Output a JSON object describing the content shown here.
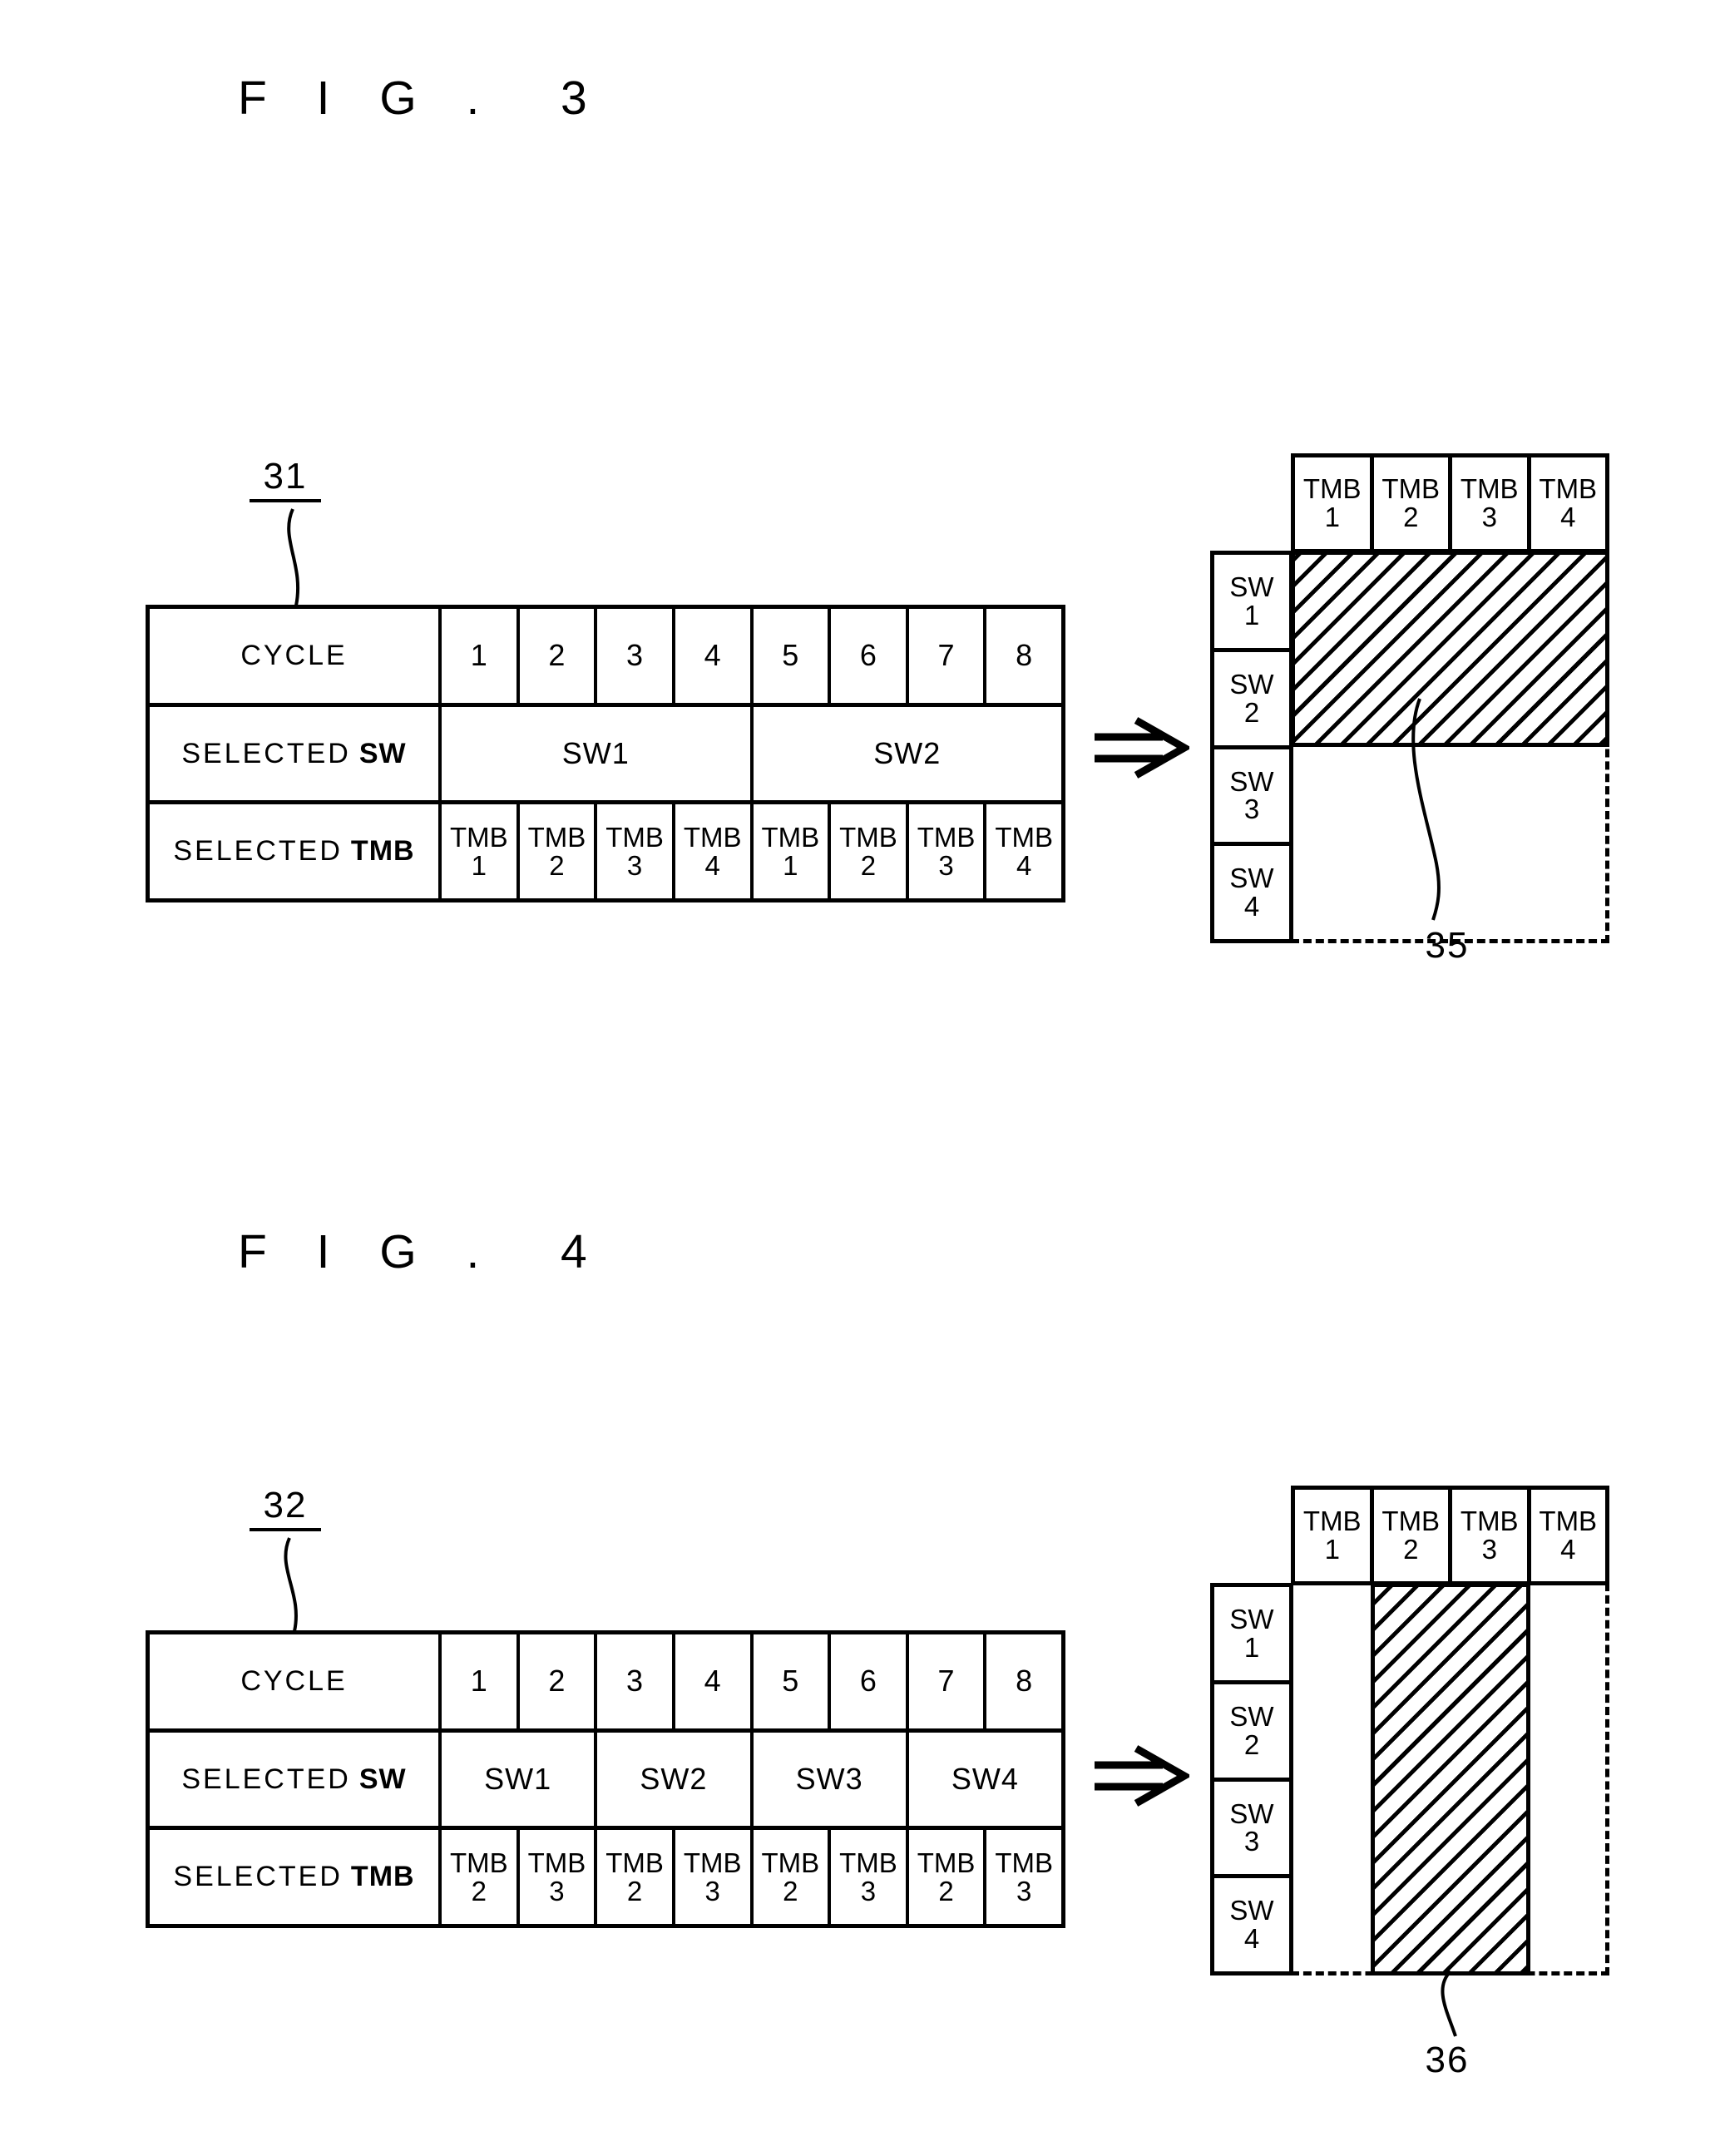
{
  "figures": [
    {
      "title": "F I G .  3",
      "table_ref": "31",
      "matrix_ref": "35",
      "arrow_icon": "double-right-arrow",
      "table": {
        "rows": [
          {
            "label": "CYCLE",
            "label_bold": "",
            "cells": [
              "1",
              "2",
              "3",
              "4",
              "5",
              "6",
              "7",
              "8"
            ]
          },
          {
            "label": "SELECTED",
            "label_bold": "SW",
            "cells": [
              "SW1",
              "SW2"
            ]
          },
          {
            "label": "SELECTED",
            "label_bold": "TMB",
            "cells": [
              "TMB\n1",
              "TMB\n2",
              "TMB\n3",
              "TMB\n4",
              "TMB\n1",
              "TMB\n2",
              "TMB\n3",
              "TMB\n4"
            ]
          }
        ]
      },
      "matrix": {
        "columns": [
          "TMB\n1",
          "TMB\n2",
          "TMB\n3",
          "TMB\n4"
        ],
        "rows": [
          "SW\n1",
          "SW\n2",
          "SW\n3",
          "SW\n4"
        ],
        "hatched_region": {
          "col_start": 1,
          "col_end": 4,
          "row_start": 1,
          "row_end": 2
        }
      }
    },
    {
      "title": "F I G .  4",
      "table_ref": "32",
      "matrix_ref": "36",
      "arrow_icon": "double-right-arrow",
      "table": {
        "rows": [
          {
            "label": "CYCLE",
            "label_bold": "",
            "cells": [
              "1",
              "2",
              "3",
              "4",
              "5",
              "6",
              "7",
              "8"
            ]
          },
          {
            "label": "SELECTED",
            "label_bold": "SW",
            "cells": [
              "SW1",
              "SW2",
              "SW3",
              "SW4"
            ]
          },
          {
            "label": "SELECTED",
            "label_bold": "TMB",
            "cells": [
              "TMB\n2",
              "TMB\n3",
              "TMB\n2",
              "TMB\n3",
              "TMB\n2",
              "TMB\n3",
              "TMB\n2",
              "TMB\n3"
            ]
          }
        ]
      },
      "matrix": {
        "columns": [
          "TMB\n1",
          "TMB\n2",
          "TMB\n3",
          "TMB\n4"
        ],
        "rows": [
          "SW\n1",
          "SW\n2",
          "SW\n3",
          "SW\n4"
        ],
        "hatched_region": {
          "col_start": 2,
          "col_end": 3,
          "row_start": 1,
          "row_end": 4
        }
      }
    }
  ],
  "colors": {
    "ink": "#000000",
    "paper": "#ffffff"
  }
}
